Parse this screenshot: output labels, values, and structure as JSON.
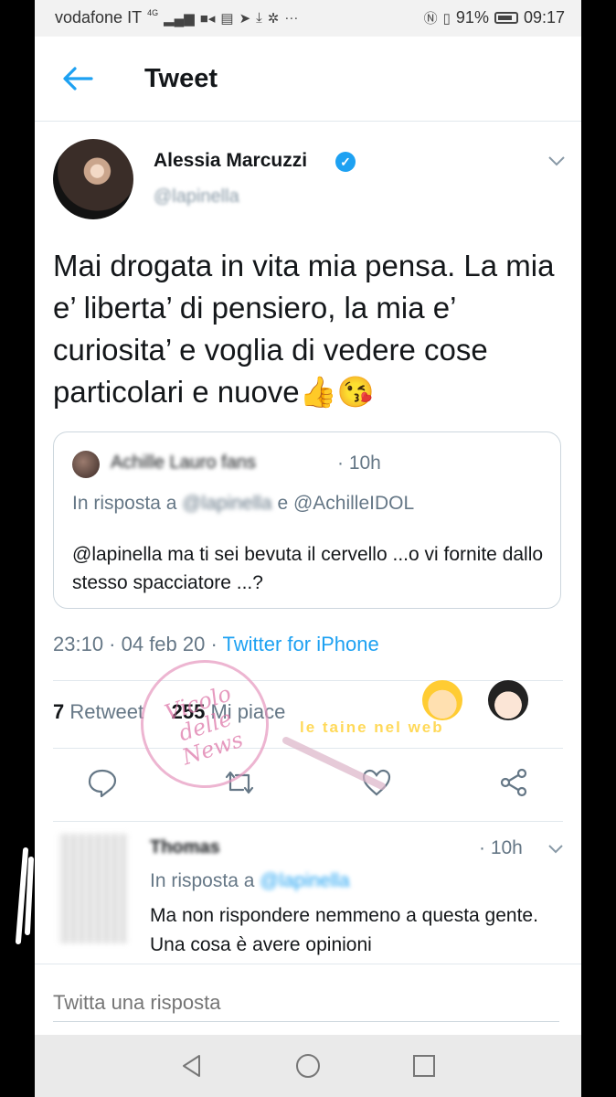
{
  "statusbar": {
    "carrier": "vodafone IT",
    "network": "4G",
    "icons": [
      "signal-icon",
      "video-icon",
      "calendar-icon",
      "telegram-icon",
      "download-icon",
      "settings-icon",
      "more-icon",
      "nfc-icon",
      "vibrate-icon",
      "battery-icon"
    ],
    "more": "···",
    "battery": "91%",
    "time": "09:17"
  },
  "header": {
    "title": "Tweet",
    "back_icon": "back-arrow-icon"
  },
  "tweet": {
    "author_name": "Alessia Marcuzzi",
    "author_handle": "@lapinella",
    "verified": true,
    "text": "Mai drogata in vita mia pensa. La mia e’ liberta’ di pensiero, la mia e’ curiosita’ e voglia di vedere cose particolari e nuove👍😘",
    "timestamp": "23:10 · 04 feb 20 · ",
    "source": "Twitter for iPhone",
    "retweets": "7",
    "retweets_label": " Retweet",
    "likes": "255",
    "likes_label": " Mi piace"
  },
  "quote": {
    "name": "Achille Lauro fans",
    "time": "· 10h",
    "reply_prefix": "In risposta a ",
    "reply_blurred": "@lapinella",
    "reply_suffix": " e @AchilleIDOL",
    "text": "@lapinella ma ti sei bevuta il cervello ...o vi fornite dallo stesso spacciatore ...?"
  },
  "watermark": {
    "circle_text": "Vicolo delle News",
    "banner_text": "le taine nel web"
  },
  "reply": {
    "name": "Thomas",
    "time": "· 10h",
    "reply_prefix": "In risposta a ",
    "reply_blurred": "@lapinella",
    "text": "Ma non rispondere nemmeno a questa gente. Una cosa è avere opinioni"
  },
  "compose": {
    "placeholder": "Twitta una risposta"
  },
  "colors": {
    "accent": "#1da1f2",
    "text": "#14171a",
    "secondary": "#657786",
    "border": "#e1e8ed"
  }
}
